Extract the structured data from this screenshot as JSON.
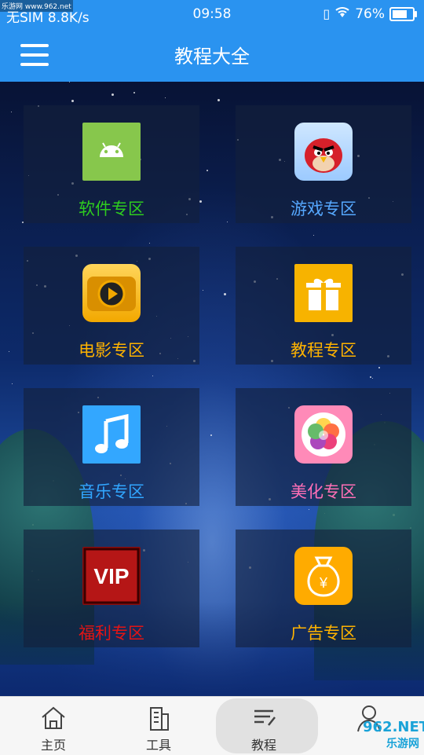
{
  "status_bar": {
    "carrier": "无SIM",
    "speed": "8.8K/s",
    "time": "09:58",
    "battery": "76%",
    "battery_level": 0.76,
    "watermark_small": "乐游网 www.962.net"
  },
  "header": {
    "title": "教程大全"
  },
  "tiles": [
    {
      "label": "软件专区",
      "color": "#2ecc1f",
      "icon": "android-icon"
    },
    {
      "label": "游戏专区",
      "color": "#56a8ff",
      "icon": "angry-bird-icon"
    },
    {
      "label": "电影专区",
      "color": "#ffb300",
      "icon": "play-icon"
    },
    {
      "label": "教程专区",
      "color": "#ffb300",
      "icon": "gift-icon"
    },
    {
      "label": "音乐专区",
      "color": "#31a6ff",
      "icon": "music-note-icon"
    },
    {
      "label": "美化专区",
      "color": "#ff6fb6",
      "icon": "flower-icon"
    },
    {
      "label": "福利专区",
      "color": "#e41414",
      "icon": "vip-icon"
    },
    {
      "label": "广告专区",
      "color": "#ffb300",
      "icon": "money-bag-icon"
    }
  ],
  "tabbar": {
    "items": [
      {
        "label": "主页",
        "icon": "home-icon"
      },
      {
        "label": "工具",
        "icon": "building-icon"
      },
      {
        "label": "教程",
        "icon": "notes-icon"
      },
      {
        "label": "",
        "icon": "person-icon"
      }
    ]
  },
  "watermark": {
    "brand": "962.NET",
    "site": "乐游网"
  }
}
